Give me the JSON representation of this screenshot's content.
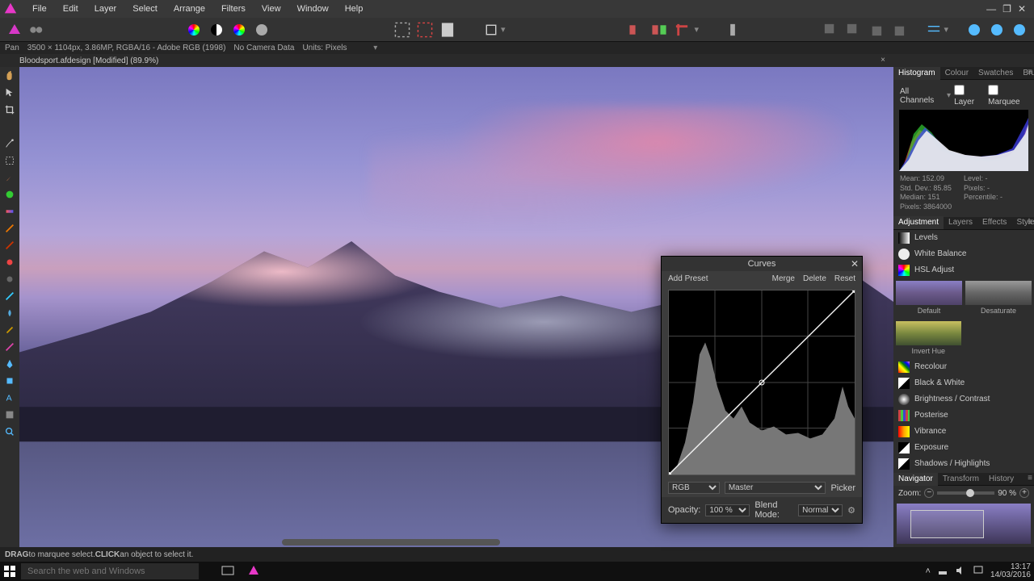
{
  "menu": [
    "File",
    "Edit",
    "Layer",
    "Select",
    "Arrange",
    "Filters",
    "View",
    "Window",
    "Help"
  ],
  "info": {
    "tool": "Pan",
    "dims": "3500 × 1104px, 3.86MP, RGBA/16 - Adobe RGB (1998)",
    "camera": "No Camera Data",
    "units_label": "Units:",
    "units": "Pixels"
  },
  "doc_tab": "Bloodsport.afdesign [Modified] (89.9%)",
  "status": {
    "drag": "DRAG",
    "drag_txt": " to marquee select. ",
    "click": "CLICK",
    "click_txt": " an object to select it."
  },
  "panels": {
    "tabs1": [
      "Histogram",
      "Colour",
      "Swatches",
      "Brushes"
    ],
    "histo": {
      "channel": "All Channels",
      "check_layer": "Layer",
      "check_marquee": "Marquee",
      "mean_l": "Mean:",
      "mean": "152.09",
      "std_l": "Std. Dev.:",
      "std": "85.85",
      "median_l": "Median:",
      "median": "151",
      "pixels_l": "Pixels:",
      "pixels": "3864000",
      "level_l": "Level:",
      "level": "-",
      "pixels2_l": "Pixels:",
      "pixels2": "-",
      "perc_l": "Percentile:",
      "perc": "-"
    },
    "tabs2": [
      "Adjustment",
      "Layers",
      "Effects",
      "Styles"
    ],
    "adjustments": [
      "Levels",
      "White Balance",
      "HSL Adjust"
    ],
    "thumbs1": [
      "Default",
      "Desaturate"
    ],
    "thumbs1b": [
      "Invert Hue"
    ],
    "adjustments2": [
      "Recolour",
      "Black & White",
      "Brightness / Contrast",
      "Posterise",
      "Vibrance",
      "Exposure",
      "Shadows / Highlights"
    ],
    "tabs3": [
      "Navigator",
      "Transform",
      "History"
    ],
    "zoom_label": "Zoom:",
    "zoom_value": "90 %"
  },
  "curves": {
    "title": "Curves",
    "add_preset": "Add Preset",
    "merge": "Merge",
    "delete": "Delete",
    "reset": "Reset",
    "channel": "RGB",
    "master": "Master",
    "picker": "Picker",
    "opacity_label": "Opacity:",
    "opacity": "100 %",
    "blend_label": "Blend Mode:",
    "blend": "Normal"
  },
  "taskbar": {
    "search_placeholder": "Search the web and Windows",
    "time": "13:17",
    "date": "14/03/2016"
  }
}
